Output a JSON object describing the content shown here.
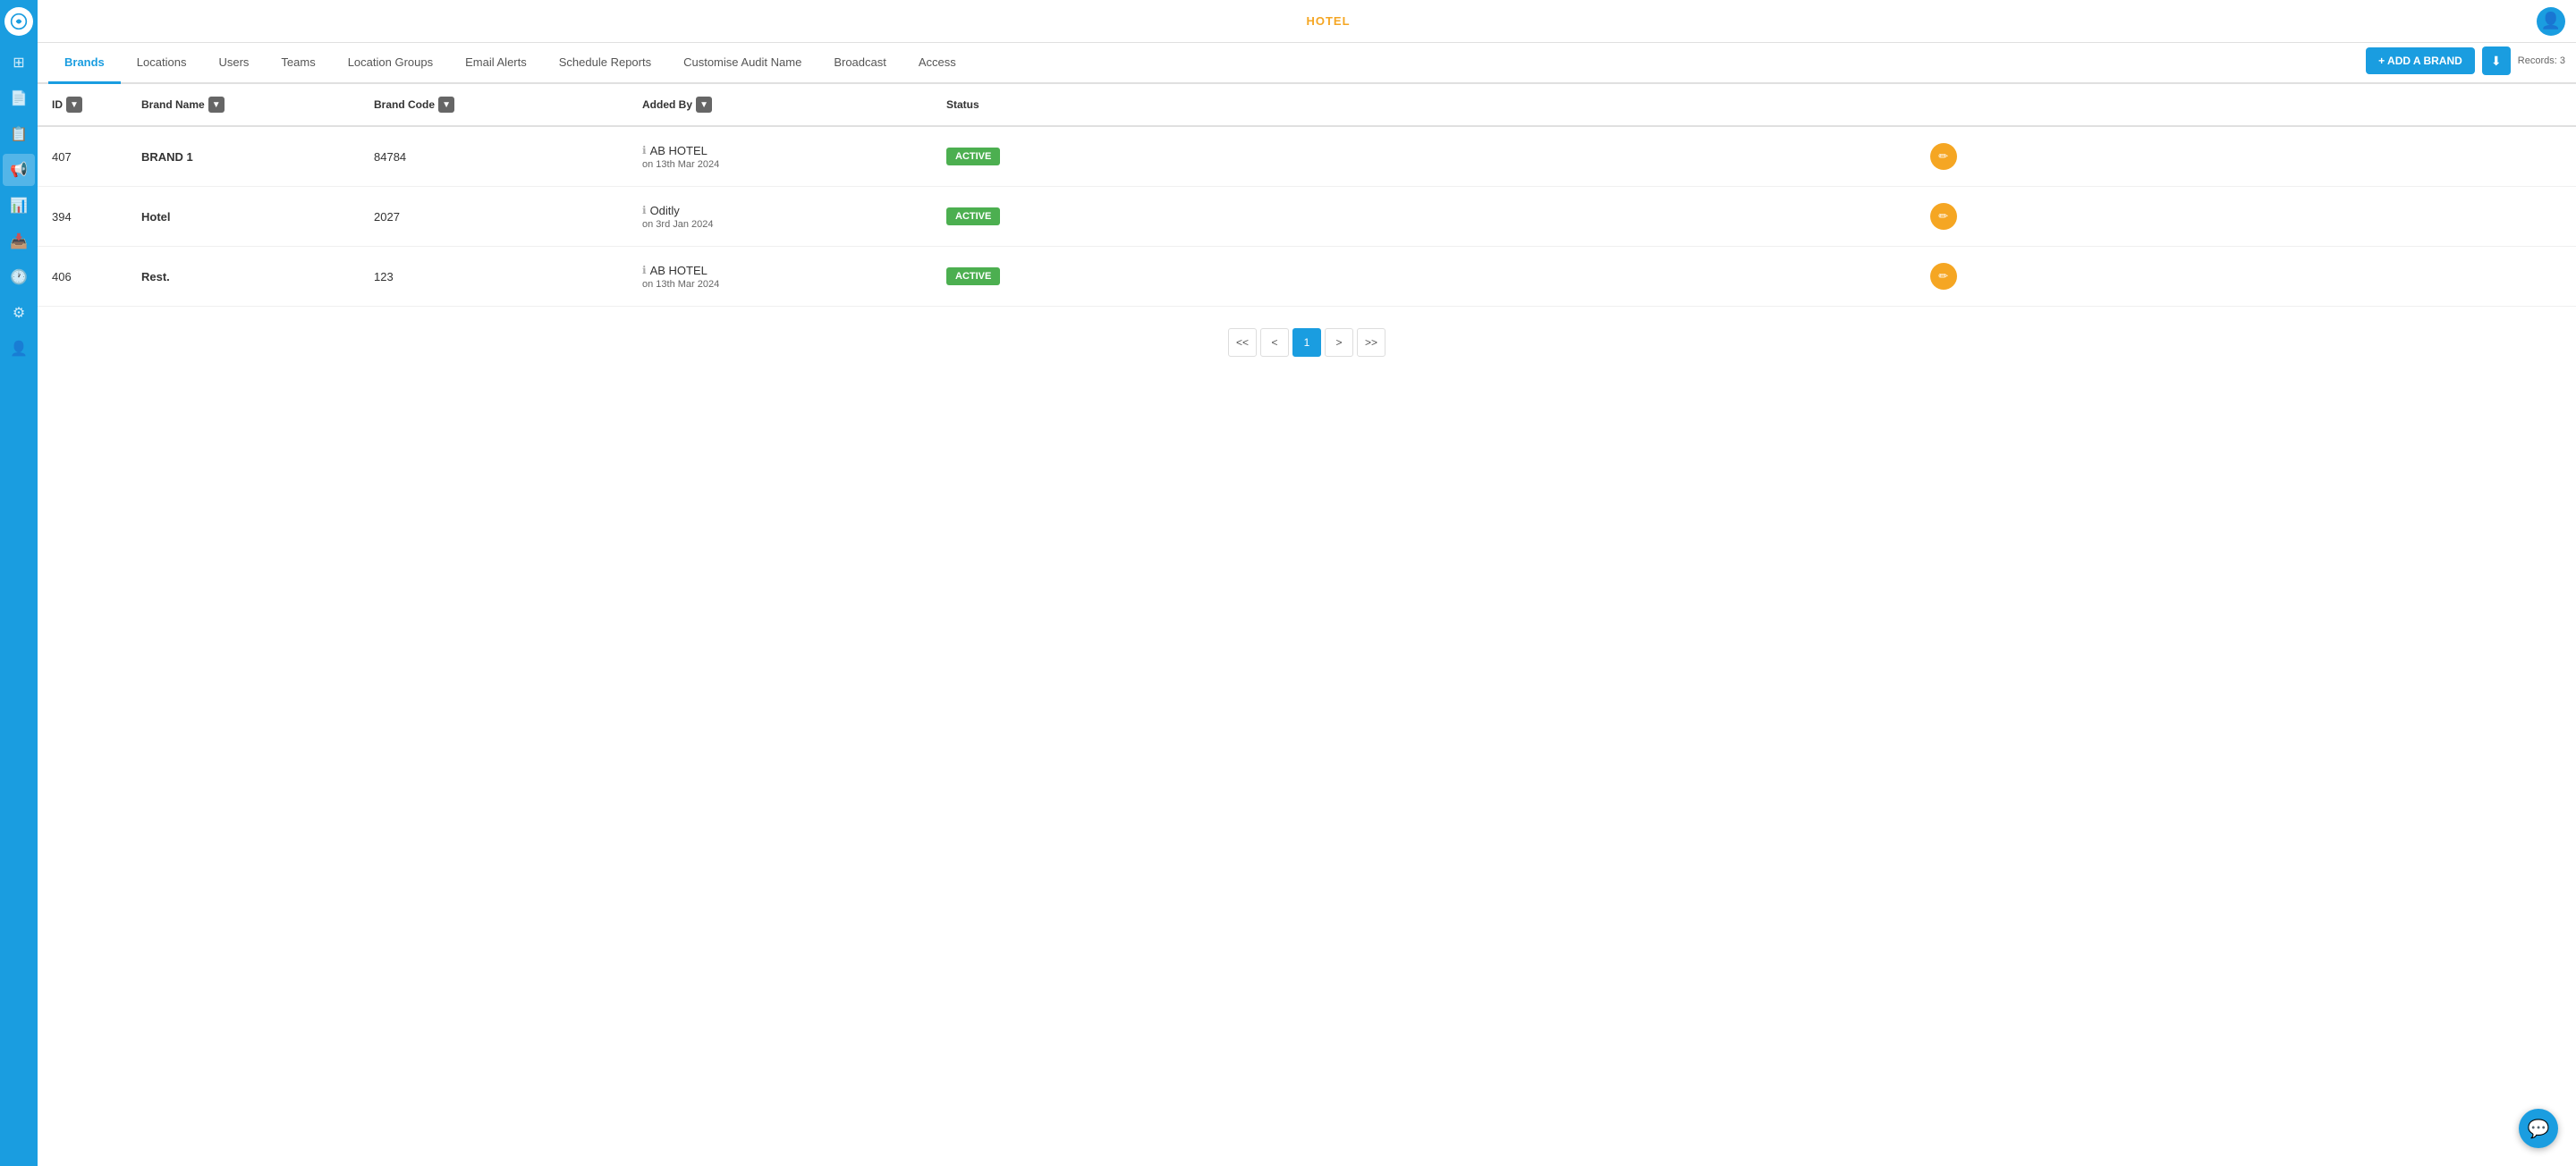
{
  "app": {
    "logo_title": "Hotel App",
    "hotel_label": "HOTEL",
    "user_icon": "👤"
  },
  "sidebar": {
    "items": [
      {
        "name": "sidebar-item-apps",
        "icon": "⊞",
        "active": false
      },
      {
        "name": "sidebar-item-document",
        "icon": "📄",
        "active": false
      },
      {
        "name": "sidebar-item-document2",
        "icon": "📋",
        "active": false
      },
      {
        "name": "sidebar-item-broadcast",
        "icon": "📢",
        "active": true
      },
      {
        "name": "sidebar-item-chart",
        "icon": "📊",
        "active": false
      },
      {
        "name": "sidebar-item-inbox",
        "icon": "📥",
        "active": false
      },
      {
        "name": "sidebar-item-clock",
        "icon": "🕐",
        "active": false
      },
      {
        "name": "sidebar-item-settings",
        "icon": "⚙",
        "active": false
      },
      {
        "name": "sidebar-item-user",
        "icon": "👤",
        "active": false
      }
    ]
  },
  "nav": {
    "tabs": [
      {
        "label": "Brands",
        "active": true
      },
      {
        "label": "Locations",
        "active": false
      },
      {
        "label": "Users",
        "active": false
      },
      {
        "label": "Teams",
        "active": false
      },
      {
        "label": "Location Groups",
        "active": false
      },
      {
        "label": "Email Alerts",
        "active": false
      },
      {
        "label": "Schedule Reports",
        "active": false
      },
      {
        "label": "Customise Audit Name",
        "active": false
      },
      {
        "label": "Broadcast",
        "active": false
      },
      {
        "label": "Access",
        "active": false
      }
    ],
    "add_brand_label": "+ ADD A BRAND",
    "records_label": "Records: 3",
    "download_icon": "⬇"
  },
  "table": {
    "columns": [
      {
        "label": "ID",
        "has_sort": true
      },
      {
        "label": "Brand Name",
        "has_sort": true
      },
      {
        "label": "Brand Code",
        "has_sort": true
      },
      {
        "label": "Added By",
        "has_sort": true
      },
      {
        "label": "Status",
        "has_sort": false
      }
    ],
    "rows": [
      {
        "id": "407",
        "brand_name": "BRAND 1",
        "brand_code": "84784",
        "added_by": "AB HOTEL",
        "added_on": "on 13th Mar 2024",
        "status": "ACTIVE"
      },
      {
        "id": "394",
        "brand_name": "Hotel",
        "brand_code": "2027",
        "added_by": "Oditly",
        "added_on": "on 3rd Jan 2024",
        "status": "ACTIVE"
      },
      {
        "id": "406",
        "brand_name": "Rest.",
        "brand_code": "123",
        "added_by": "AB HOTEL",
        "added_on": "on 13th Mar 2024",
        "status": "ACTIVE"
      }
    ]
  },
  "pagination": {
    "first_label": "<<",
    "prev_label": "<",
    "current": "1",
    "next_label": ">",
    "last_label": ">>"
  },
  "chat": {
    "icon": "💬"
  }
}
